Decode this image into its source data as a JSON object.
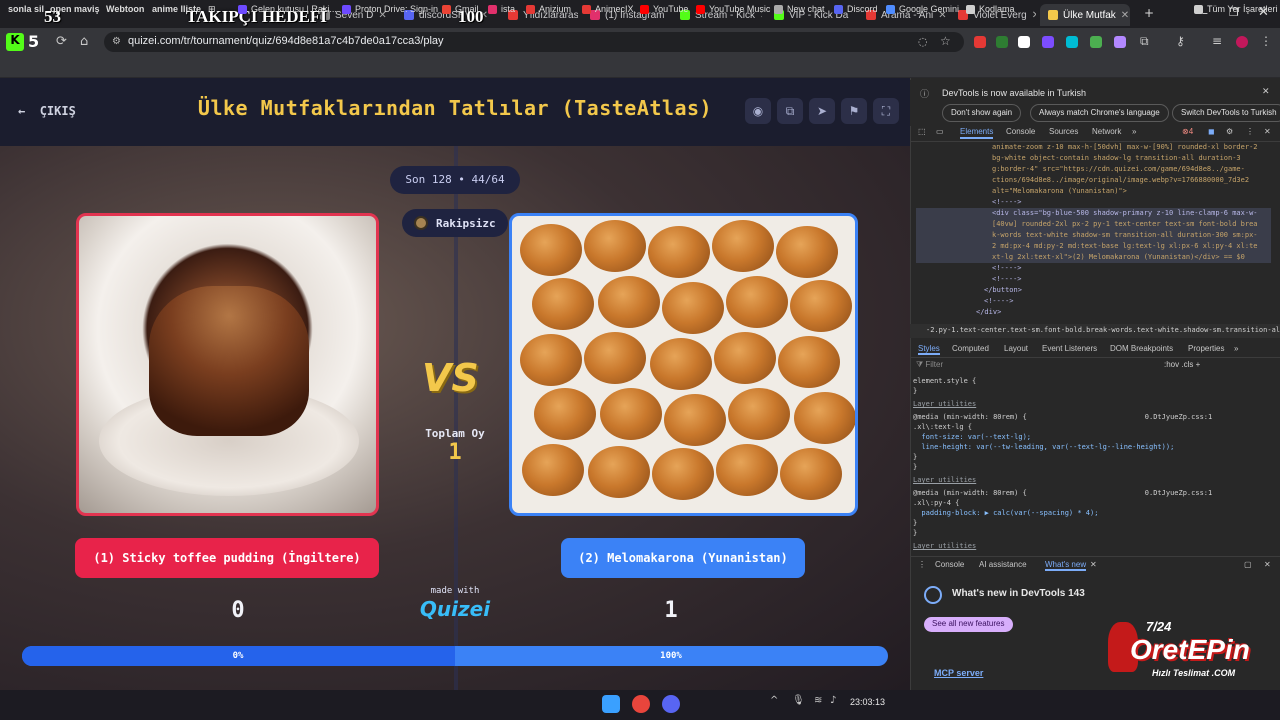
{
  "overlay": {
    "left_num": "53",
    "center_text": "TAKIPÇI HEDEFİ",
    "right_num": "100"
  },
  "tabs": [
    {
      "label": "Seven D",
      "color": "#888888"
    },
    {
      "label": "discordSRV",
      "color": "#5865f2"
    },
    {
      "label": "Yıldızlararası",
      "color": "#e53935"
    },
    {
      "label": "(1) Instagram",
      "color": "#e1306c"
    },
    {
      "label": "Stream - Kick",
      "color": "#53fc18"
    },
    {
      "label": "VIP - Kick Da",
      "color": "#53fc18"
    },
    {
      "label": "Arama - Ani",
      "color": "#e53935"
    },
    {
      "label": "Violet Everg",
      "color": "#e53935"
    },
    {
      "label": "Ülke Mutfak",
      "color": "#f3c84b"
    }
  ],
  "address": {
    "url": "quizei.com/tr/tournament/quiz/694d8e81a7c4b7de0a17cca3/play",
    "kick_count": "5"
  },
  "bookmarks": [
    {
      "label": "sonla sil",
      "color": "#888888"
    },
    {
      "label": "open maviş",
      "color": "#888888"
    },
    {
      "label": "Webtoon",
      "color": "#00d564"
    },
    {
      "label": "anime lliste",
      "color": "#888888"
    },
    {
      "label": "Gelen kutusu | Raki...",
      "color": "#6d4aff"
    },
    {
      "label": "Proton Drive: Sign-in",
      "color": "#6d4aff"
    },
    {
      "label": "Gmail",
      "color": "#ea4335"
    },
    {
      "label": "ista",
      "color": "#e1306c"
    },
    {
      "label": "Anizium",
      "color": "#e53935"
    },
    {
      "label": "AnimecIX",
      "color": "#e53935"
    },
    {
      "label": "YouTube",
      "color": "#ff0000"
    },
    {
      "label": "YouTube Music",
      "color": "#ff0000"
    },
    {
      "label": "New chat",
      "color": "#aaaaaa"
    },
    {
      "label": "Discord",
      "color": "#5865f2"
    },
    {
      "label": "Google Gemini",
      "color": "#4f8cff"
    },
    {
      "label": "Kodlama",
      "color": "#cfcfcf"
    }
  ],
  "all_bookmarks": "Tüm Yer İşaretleri",
  "page": {
    "back_label": "ÇIKIŞ",
    "title": "Ülke Mutfaklarından Tatlılar (TasteAtlas)",
    "round": "Son 128 • 44/64",
    "opponent": "Rakipsizc",
    "vs": "VS",
    "total_label": "Toplam Oy",
    "total_value": "1",
    "left_choice": "(1) Sticky toffee pudding (İngiltere)",
    "right_choice": "(2) Melomakarona (Yunanistan)",
    "made_with": "made with",
    "logo": "Quizei",
    "left_score": "0",
    "right_score": "1",
    "left_pct_label": "0%",
    "right_pct_label": "100%",
    "left_fraction": 0.5,
    "accent_left": "#e8234a",
    "accent_right": "#3b82f6",
    "title_color": "#f3c84b"
  },
  "devtools": {
    "notice": "DevTools is now available in Turkish",
    "btn_dont_show": "Don't show again",
    "btn_match": "Always match Chrome's language",
    "btn_switch": "Switch DevTools to Turkish",
    "tabs": [
      "Elements",
      "Console",
      "Sources",
      "Network"
    ],
    "error_count": "4",
    "dom_lines": [
      "animate-zoom z-10 max-h-[50dvh] max-w-[90%] rounded-xl border-2",
      "bg-white object-contain shadow-lg transition-all duration-3",
      "g:border-4\" src=\"https://cdn.quizei.com/game/694d8e8../game-",
      "ctions/694d8e8../image/original/image.webp?v=1766880000_7d3e2",
      "alt=\"Melomakarona (Yunanistan)\">",
      "<!---->",
      "<div class=\"bg-blue-500 shadow-primary z-10 line-clamp-6 max-w-",
      "[40vw] rounded-2xl px-2 py-1 text-center text-sm font-bold brea",
      "k-words text-white shadow-sm transition-all duration-300 sm:px-",
      "2 md:px-4 md:py-2 md:text-base lg:text-lg xl:px-6 xl:py-4 xl:te",
      "xt-lg 2xl:text-xl\">(2) Melomakarona (Yunanistan)</div> == $0",
      "<!---->",
      "<!---->",
      "</button>",
      "<!---->",
      "</div>"
    ],
    "crumb": "-2.py-1.text-center.text-sm.font-bold.break-words.text-white.shadow-sm.transition-all.duration-",
    "style_tabs": [
      "Styles",
      "Computed",
      "Layout",
      "Event Listeners",
      "DOM Breakpoints",
      "Properties"
    ],
    "filter_placeholder": "Filter",
    "css_lines": [
      "element.style {",
      "}",
      "Layer utilities",
      "@media (min-width: 80rem) {                            0.DtJyueZp.css:1",
      ".xl\\:text-lg {",
      "  font-size: var(--text-lg);",
      "  line-height: var(--tw-leading, var(--text-lg--line-height));",
      "}",
      "}",
      "Layer utilities",
      "@media (min-width: 80rem) {                            0.DtJyueZp.css:1",
      ".xl\\:py-4 {",
      "  padding-block: ▶ calc(var(--spacing) * 4);",
      "}",
      "}",
      "Layer utilities"
    ],
    "drawer_tabs": [
      "Console",
      "AI assistance",
      "What's new"
    ],
    "whatsnew_title": "What's new in DevTools 143",
    "see_all": "See all new features",
    "mcp": "MCP server"
  },
  "watermark": {
    "count": "7/24",
    "logo": "OretEPin",
    "sub": "Hızlı Teslimat .COM"
  },
  "taskbar": {
    "time": "23:03:13"
  }
}
